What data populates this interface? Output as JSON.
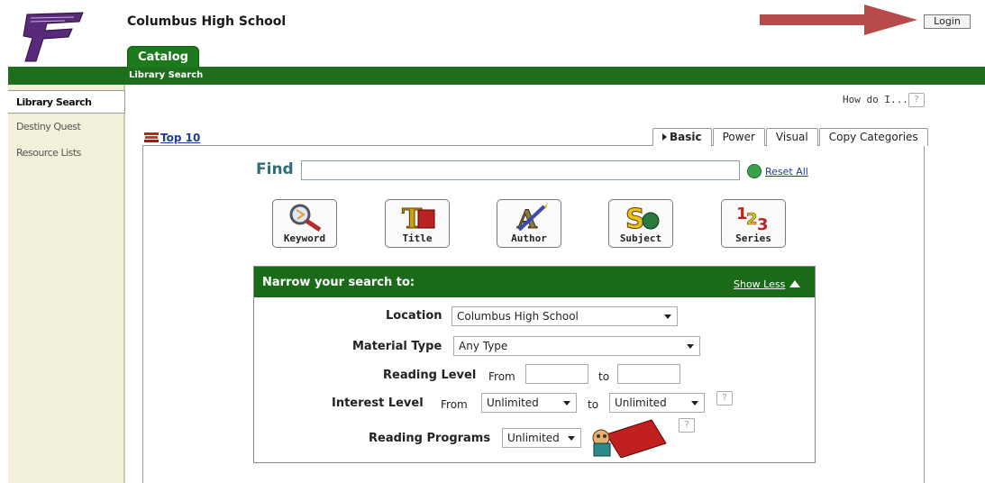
{
  "header": {
    "school_name": "Columbus High School",
    "login_label": "Login",
    "catalog_tab": "Catalog",
    "subnav_label": "Library Search"
  },
  "sidebar": {
    "items": [
      {
        "label": "Library Search",
        "active": true
      },
      {
        "label": "Destiny Quest",
        "active": false
      },
      {
        "label": "Resource Lists",
        "active": false
      }
    ]
  },
  "help": {
    "how_do_i": "How do I...",
    "help_mark": "?"
  },
  "top10": "Top 10",
  "search_tabs": [
    "Basic",
    "Power",
    "Visual",
    "Copy Categories"
  ],
  "find": {
    "label": "Find",
    "value": "",
    "reset_label": "Reset All"
  },
  "search_buttons": [
    "Keyword",
    "Title",
    "Author",
    "Subject",
    "Series"
  ],
  "narrow": {
    "title": "Narrow your search to:",
    "show_less": "Show Less",
    "location_label": "Location",
    "location_value": "Columbus High School",
    "material_label": "Material Type",
    "material_value": "Any Type",
    "reading_level_label": "Reading Level",
    "from_label": "From",
    "to_label": "to",
    "interest_level_label": "Interest Level",
    "interest_from_value": "Unlimited",
    "interest_to_value": "Unlimited",
    "reading_programs_label": "Reading Programs",
    "reading_programs_value": "Unlimited"
  },
  "colors": {
    "brand_green": "#1e6e1e",
    "sidebar_bg": "#f2f0d8",
    "link_blue": "#1a3c9c",
    "arrow_red": "#b03a3a"
  }
}
